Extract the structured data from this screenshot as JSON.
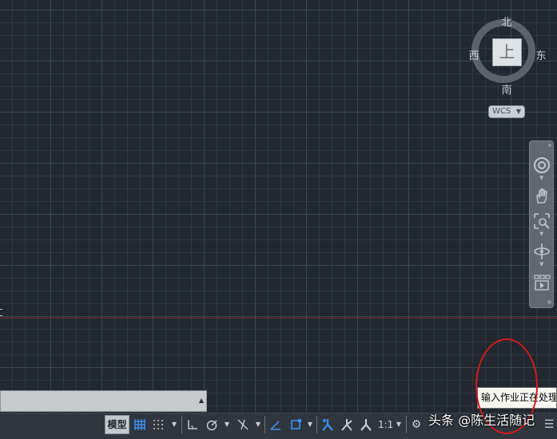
{
  "viewcube": {
    "north": "北",
    "south": "南",
    "west": "西",
    "east": "东",
    "face": "上",
    "ucs_label": "WCS"
  },
  "navbar": {
    "tools": [
      "steering-wheel-icon",
      "pan-icon",
      "zoom-extents-icon",
      "orbit-icon",
      "showmotion-icon"
    ]
  },
  "statusbar": {
    "model_label": "模型",
    "scale_label": "1:1",
    "tools": [
      "grid-icon",
      "snap-icon",
      "ortho-icon",
      "polar-icon",
      "isodraft-icon",
      "dynamic-ucs-icon",
      "object-snap-icon",
      "annotation-visibility-icon",
      "autoscale-icon",
      "annotation-scale-icon",
      "workspace-gear-icon",
      "customize-icon"
    ]
  },
  "tooltip": {
    "text": "输入作业正在处理"
  },
  "watermark": {
    "text": "头条 @陈生活随记"
  },
  "colors": {
    "canvas_bg": "#212830",
    "accent_blue": "#3d8ff0",
    "annotation_red": "#d31b1b"
  }
}
